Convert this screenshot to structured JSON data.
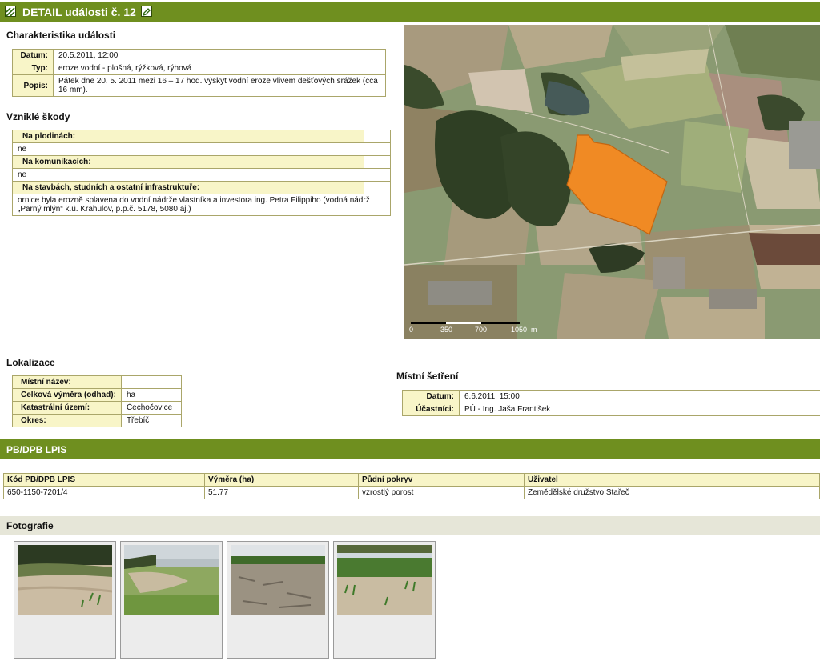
{
  "header": {
    "title": "DETAIL události č. 12"
  },
  "charakteristika": {
    "section_title": "Charakteristika události",
    "rows": [
      {
        "label": "Datum:",
        "value": "20.5.2011, 12:00"
      },
      {
        "label": "Typ:",
        "value": "eroze vodní - plošná, rýžková, rýhová"
      },
      {
        "label": "Popis:",
        "value": "Pátek dne 20. 5. 2011 mezi 16 – 17 hod. výskyt vodní eroze vlivem dešťových srážek (cca 16 mm)."
      }
    ]
  },
  "skody": {
    "section_title": "Vzniklé škody",
    "groups": [
      {
        "header": "Na plodinách:",
        "value": "ne"
      },
      {
        "header": "Na komunikacích:",
        "value": "ne"
      },
      {
        "header": "Na stavbách, studních a ostatní infrastruktuře:",
        "value": "ornice byla erozně splavena do vodní nádrže vlastníka a investora ing. Petra Filippiho (vodná nádrž „Parný mlýn“ k.ú. Krahulov, p.p.č. 5178, 5080 aj.)"
      }
    ]
  },
  "map": {
    "scale_labels": [
      "0",
      "350",
      "700",
      "1050"
    ],
    "unit": "m",
    "colors": {
      "polygon": "#f08a24",
      "polygon_border": "#c46510"
    }
  },
  "lokalizace": {
    "section_title": "Lokalizace",
    "rows": [
      {
        "label": "Místní název:",
        "value": ""
      },
      {
        "label": "Celková výměra (odhad):",
        "value": "ha"
      },
      {
        "label": "Katastrální území:",
        "value": "Čechočovice"
      },
      {
        "label": "Okres:",
        "value": "Třebíč"
      }
    ]
  },
  "setreni": {
    "section_title": "Místní šetření",
    "rows": [
      {
        "label": "Datum:",
        "value": "6.6.2011, 15:00"
      },
      {
        "label": "Účastníci:",
        "value": "PÚ - Ing. Jaša František"
      }
    ]
  },
  "lpis": {
    "bar_title": "PB/DPB LPIS",
    "columns": [
      "Kód PB/DPB LPIS",
      "Výměra (ha)",
      "Půdní pokryv",
      "Uživatel"
    ],
    "rows": [
      [
        "650-1150-7201/4",
        "51.77",
        "vzrostlý porost",
        "Zemědělské družstvo Stařeč"
      ]
    ]
  },
  "fotografie": {
    "bar_title": "Fotografie",
    "photos": [
      "photo-1",
      "photo-2",
      "photo-3",
      "photo-4"
    ]
  },
  "icons": {
    "header_left": "map-icon",
    "header_right": "edit-icon"
  }
}
